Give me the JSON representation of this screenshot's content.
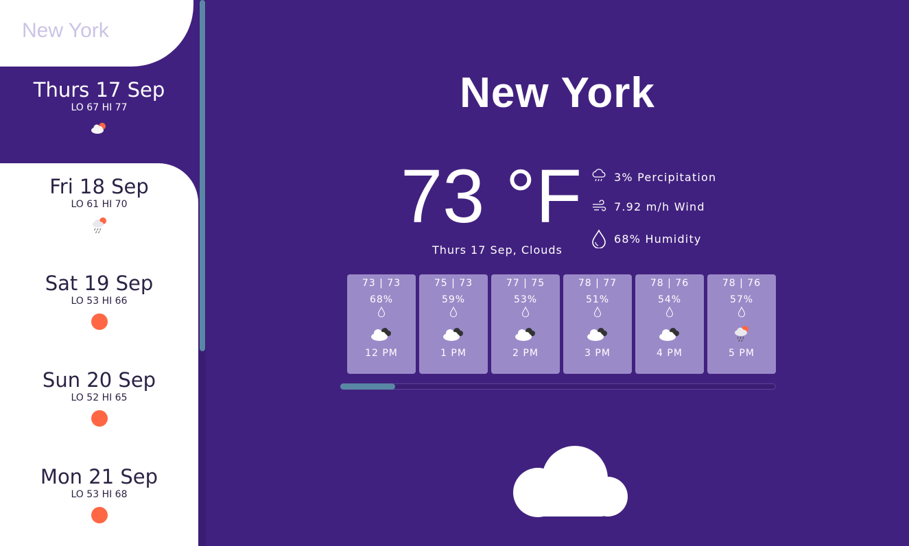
{
  "search": {
    "placeholder": "New York"
  },
  "days": [
    {
      "title": "Thurs 17 Sep",
      "lo_label": "LO",
      "lo": "67",
      "hi_label": "HI",
      "hi": "77",
      "icon": "cloud-sun-icon",
      "selected": true
    },
    {
      "title": "Fri 18 Sep",
      "lo_label": "LO",
      "lo": "61",
      "hi_label": "HI",
      "hi": "70",
      "icon": "rain-sun-icon",
      "selected": false
    },
    {
      "title": "Sat 19 Sep",
      "lo_label": "LO",
      "lo": "53",
      "hi_label": "HI",
      "hi": "66",
      "icon": "sun-icon",
      "selected": false
    },
    {
      "title": "Sun 20 Sep",
      "lo_label": "LO",
      "lo": "52",
      "hi_label": "HI",
      "hi": "65",
      "icon": "sun-icon",
      "selected": false
    },
    {
      "title": "Mon 21 Sep",
      "lo_label": "LO",
      "lo": "53",
      "hi_label": "HI",
      "hi": "68",
      "icon": "sun-icon",
      "selected": false
    }
  ],
  "current": {
    "city": "New York",
    "temperature": "73 °F",
    "date_condition": "Thurs 17 Sep, Clouds",
    "stats": {
      "precipitation": "3% Percipitation",
      "wind": "7.92 m/h Wind",
      "humidity": "68% Humidity"
    }
  },
  "hourly": [
    {
      "hilo": "73 | 73",
      "humidity": "68%",
      "icon": "dark-clouds-icon",
      "time": "12 PM"
    },
    {
      "hilo": "75 | 73",
      "humidity": "59%",
      "icon": "dark-clouds-icon",
      "time": "1 PM"
    },
    {
      "hilo": "77 | 75",
      "humidity": "53%",
      "icon": "dark-clouds-icon",
      "time": "2 PM"
    },
    {
      "hilo": "78 | 77",
      "humidity": "51%",
      "icon": "dark-clouds-icon",
      "time": "3 PM"
    },
    {
      "hilo": "78 | 76",
      "humidity": "54%",
      "icon": "dark-clouds-icon",
      "time": "4 PM"
    },
    {
      "hilo": "78 | 76",
      "humidity": "57%",
      "icon": "rain-sun-icon",
      "time": "5 PM"
    }
  ],
  "colors": {
    "background": "#41217f",
    "card": "#9b8ac8",
    "accent_sun": "#ff6744",
    "scroll_thumb": "#5a87a5"
  }
}
